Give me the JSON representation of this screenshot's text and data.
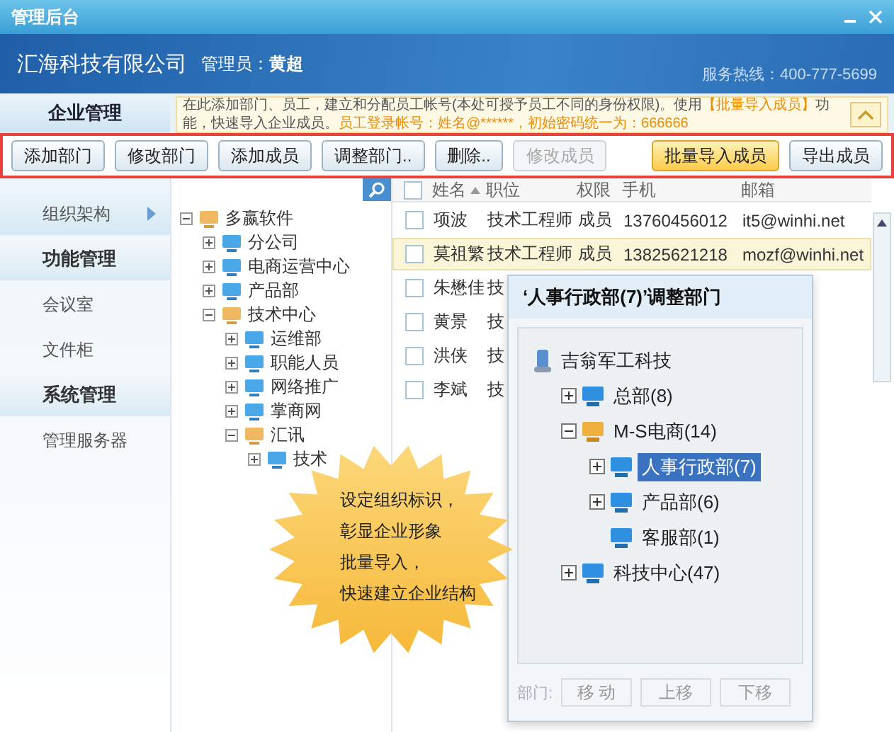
{
  "window": {
    "title": "管理后台"
  },
  "header": {
    "company": "汇海科技有限公司",
    "admin_label": "管理员：",
    "admin_name": "黄超",
    "hotline": "服务热线：400-777-5699"
  },
  "notice": {
    "segments": [
      {
        "text": "在此添加部门、员工，建立和分配员工帐号(本处可授予员工不同的身份权限)。使用",
        "emphasis": false
      },
      {
        "text": "【批量导入成员】",
        "emphasis": true
      },
      {
        "text": "功能，快速导入企业成员。",
        "emphasis": false
      },
      {
        "text": "员工登录帐号：姓名@******，初始密码统一为：666666",
        "emphasis": true
      }
    ]
  },
  "sidebar": {
    "items": [
      {
        "label": "企业管理",
        "kind": "heading",
        "selected": false
      },
      {
        "label": "组织架构",
        "kind": "item",
        "selected": true
      },
      {
        "label": "功能管理",
        "kind": "heading",
        "selected": false
      },
      {
        "label": "会议室",
        "kind": "item",
        "selected": false
      },
      {
        "label": "文件柜",
        "kind": "item",
        "selected": false
      },
      {
        "label": "系统管理",
        "kind": "heading",
        "selected": false
      },
      {
        "label": "管理服务器",
        "kind": "item",
        "selected": false
      }
    ]
  },
  "toolbar": {
    "buttons": [
      {
        "label": "添加部门",
        "disabled": false,
        "highlighted": false
      },
      {
        "label": "修改部门",
        "disabled": false,
        "highlighted": false
      },
      {
        "label": "添加成员",
        "disabled": false,
        "highlighted": false
      },
      {
        "label": "调整部门..",
        "disabled": false,
        "highlighted": false
      },
      {
        "label": "删除..",
        "disabled": false,
        "highlighted": false
      },
      {
        "label": "修改成员",
        "disabled": true,
        "highlighted": false
      }
    ],
    "right_buttons": [
      {
        "label": "批量导入成员",
        "disabled": false,
        "highlighted": true
      },
      {
        "label": "导出成员",
        "disabled": false,
        "highlighted": false
      }
    ]
  },
  "tree": {
    "nodes": [
      {
        "label": "多嬴软件",
        "expanded": true,
        "children": [
          {
            "label": "分公司",
            "expanded": false
          },
          {
            "label": "电商运营中心",
            "expanded": false
          },
          {
            "label": "产品部",
            "expanded": false
          },
          {
            "label": "技术中心",
            "expanded": true,
            "children": [
              {
                "label": "运维部",
                "expanded": false
              },
              {
                "label": "职能人员",
                "expanded": false
              },
              {
                "label": "网络推广",
                "expanded": false
              },
              {
                "label": "掌商网",
                "expanded": false
              },
              {
                "label": "汇讯",
                "expanded": true,
                "children": [
                  {
                    "label": "技术",
                    "expanded": false
                  }
                ]
              }
            ]
          }
        ]
      }
    ]
  },
  "table": {
    "header_checked": false,
    "columns": [
      {
        "label": "姓名",
        "sorted": true
      },
      {
        "label": "职位",
        "sorted": false
      },
      {
        "label": "权限",
        "sorted": false
      },
      {
        "label": "手机",
        "sorted": false
      },
      {
        "label": "邮箱",
        "sorted": false
      }
    ],
    "rows": [
      {
        "checked": false,
        "selected": false,
        "cells": [
          "项波",
          "技术工程师",
          "成员",
          "13760456012",
          "it5@winhi.net"
        ]
      },
      {
        "checked": false,
        "selected": true,
        "cells": [
          "莫祖繁",
          "技术工程师",
          "成员",
          "13825621218",
          "mozf@winhi.net"
        ]
      },
      {
        "checked": false,
        "selected": false,
        "cells": [
          "朱懋佳",
          "技"
        ]
      },
      {
        "checked": false,
        "selected": false,
        "cells": [
          "黄景",
          "技"
        ]
      },
      {
        "checked": false,
        "selected": false,
        "cells": [
          "洪侠",
          "技"
        ]
      },
      {
        "checked": false,
        "selected": false,
        "cells": [
          "李斌",
          "技"
        ]
      }
    ]
  },
  "dialog": {
    "title": "‘人事行政部(7)’调整部门",
    "nodes": [
      {
        "label": "吉翁军工科技",
        "kind": "root",
        "children": [
          {
            "label": "总部(8)",
            "kind": "dept",
            "expanded": false,
            "selected": false
          },
          {
            "label": "M-S电商(14)",
            "kind": "dept",
            "expanded": true,
            "selected": false,
            "children": [
              {
                "label": "人事行政部(7)",
                "kind": "dept",
                "expanded": false,
                "selected": true
              },
              {
                "label": "产品部(6)",
                "kind": "dept",
                "expanded": false,
                "selected": false
              },
              {
                "label": "客服部(1)",
                "kind": "dept",
                "selected": false
              }
            ]
          },
          {
            "label": "科技中心(47)",
            "kind": "dept",
            "expanded": false,
            "selected": false
          }
        ]
      }
    ],
    "footer_label": "部门:",
    "buttons": [
      "移 动",
      "上移",
      "下移"
    ]
  },
  "callout": {
    "lines": [
      "设定组织标识，",
      "彰显企业形象",
      "批量导入，",
      "快速建立企业结构"
    ]
  }
}
